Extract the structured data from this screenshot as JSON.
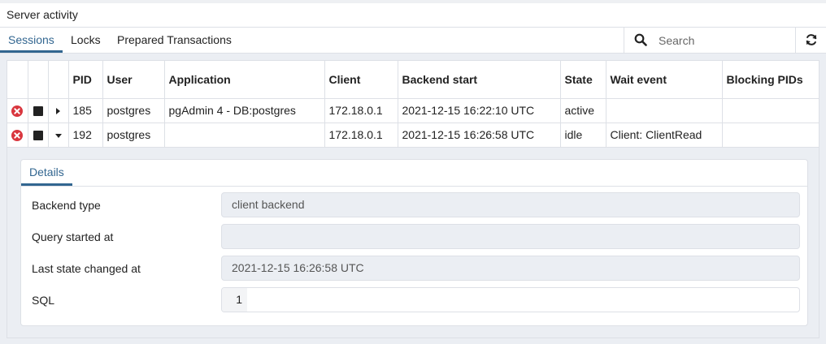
{
  "panel": {
    "title": "Server activity"
  },
  "tabs": [
    {
      "label": "Sessions",
      "active": true
    },
    {
      "label": "Locks",
      "active": false
    },
    {
      "label": "Prepared Transactions",
      "active": false
    }
  ],
  "search": {
    "placeholder": "Search",
    "value": "",
    "icon": "search-icon"
  },
  "toolbar": {
    "refresh_icon": "refresh-icon"
  },
  "table": {
    "columns": [
      "",
      "",
      "",
      "PID",
      "User",
      "Application",
      "Client",
      "Backend start",
      "State",
      "Wait event",
      "Blocking PIDs"
    ],
    "rows": [
      {
        "expanded": false,
        "pid": "185",
        "user": "postgres",
        "application": "pgAdmin 4 - DB:postgres",
        "client": "172.18.0.1",
        "backend_start": "2021-12-15 16:22:10 UTC",
        "state": "active",
        "wait_event": "",
        "blocking_pids": ""
      },
      {
        "expanded": true,
        "pid": "192",
        "user": "postgres",
        "application": "",
        "client": "172.18.0.1",
        "backend_start": "2021-12-15 16:26:58 UTC",
        "state": "idle",
        "wait_event": "Client: ClientRead",
        "blocking_pids": ""
      }
    ]
  },
  "details": {
    "tab_label": "Details",
    "fields": {
      "backend_type": {
        "label": "Backend type",
        "value": "client backend"
      },
      "query_started_at": {
        "label": "Query started at",
        "value": ""
      },
      "last_state_changed_at": {
        "label": "Last state changed at",
        "value": "2021-12-15 16:26:58 UTC"
      },
      "sql": {
        "label": "SQL",
        "line_number": "1",
        "value": ""
      }
    }
  },
  "colors": {
    "accent": "#326690",
    "cancel_red": "#d9363e",
    "background": "#ebeef3",
    "border": "#dde0e6"
  }
}
